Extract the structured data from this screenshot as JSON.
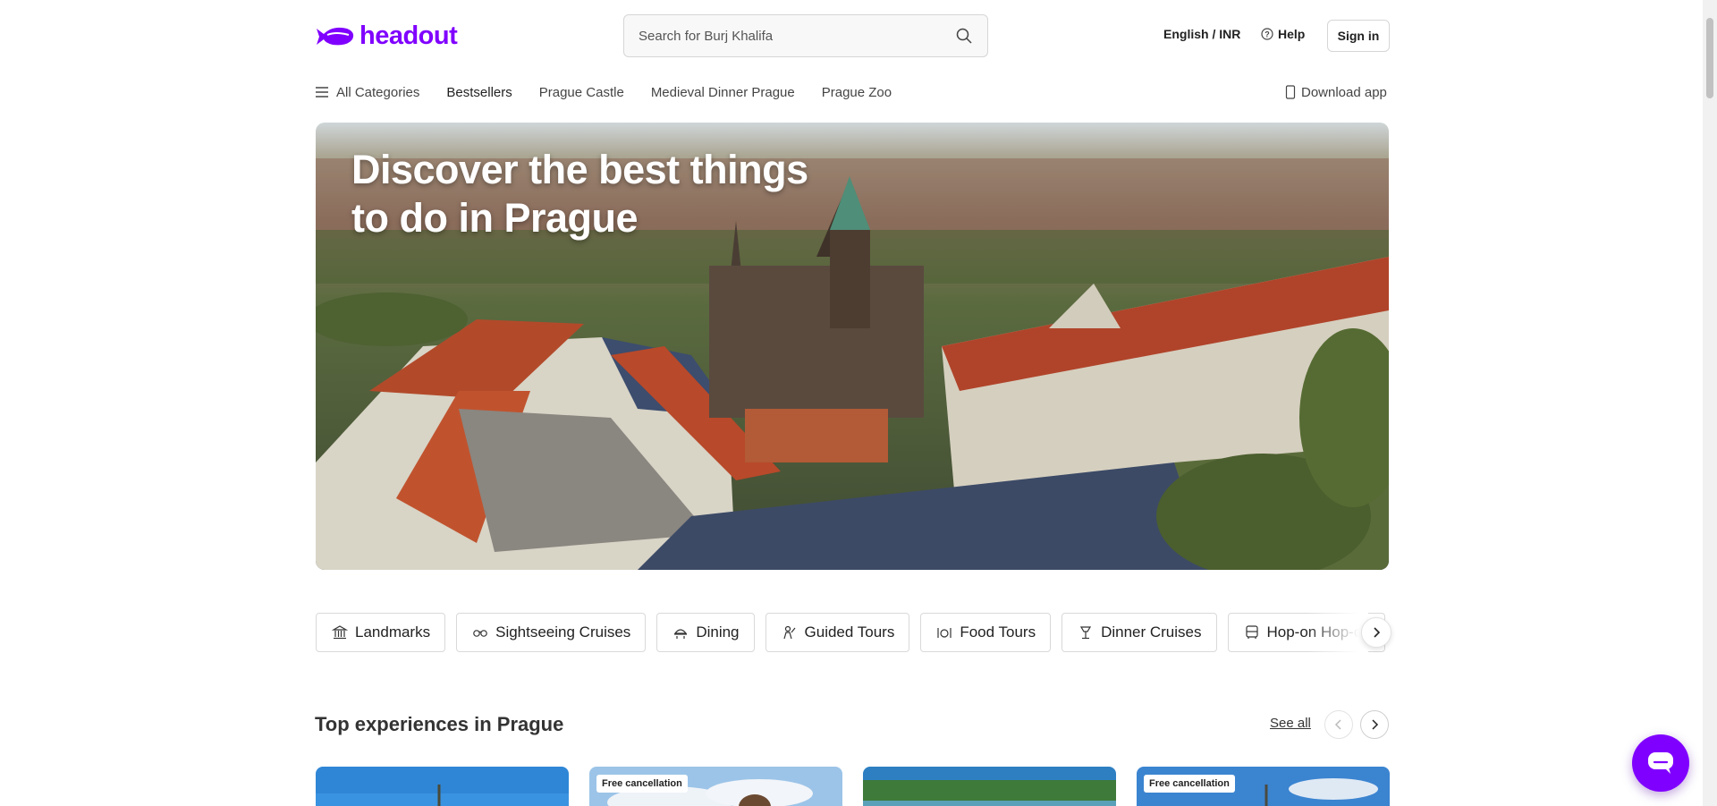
{
  "brand": {
    "name": "headout",
    "color": "#8000ff"
  },
  "search": {
    "placeholder": "Search for Burj Khalifa",
    "icon": "search-icon"
  },
  "header": {
    "language_currency": "English / INR",
    "help_label": "Help",
    "signin_label": "Sign in"
  },
  "nav": {
    "items": [
      {
        "label": "All Categories",
        "icon": "menu-icon"
      },
      {
        "label": "Bestsellers"
      },
      {
        "label": "Prague Castle"
      },
      {
        "label": "Medieval Dinner Prague"
      },
      {
        "label": "Prague Zoo"
      }
    ],
    "download_label": "Download app"
  },
  "hero": {
    "title": "Discover the best things to do in Prague"
  },
  "categories": [
    {
      "label": "Landmarks",
      "icon": "landmark-icon"
    },
    {
      "label": "Sightseeing Cruises",
      "icon": "cruise-icon"
    },
    {
      "label": "Dining",
      "icon": "dining-icon"
    },
    {
      "label": "Guided Tours",
      "icon": "guide-icon"
    },
    {
      "label": "Food Tours",
      "icon": "food-icon"
    },
    {
      "label": "Dinner Cruises",
      "icon": "dinner-cruise-icon"
    },
    {
      "label": "Hop-on Hop-off",
      "icon": "bus-icon"
    }
  ],
  "section": {
    "title": "Top experiences in Prague",
    "see_all": "See all",
    "cards": [
      {
        "badge": ""
      },
      {
        "badge": "Free cancellation"
      },
      {
        "badge": ""
      },
      {
        "badge": "Free cancellation"
      }
    ]
  }
}
